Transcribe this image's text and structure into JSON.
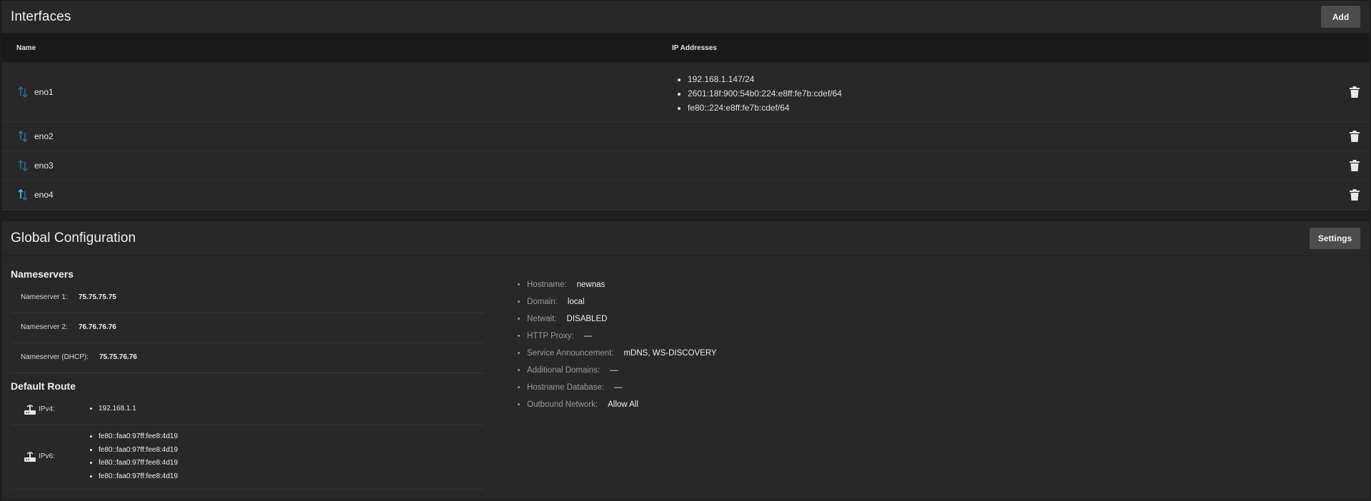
{
  "interfaces": {
    "title": "Interfaces",
    "add_label": "Add",
    "columns": {
      "name": "Name",
      "ip": "IP Addresses"
    },
    "rows": [
      {
        "name": "eno1",
        "ips": [
          "192.168.1.147/24",
          "2601:18f:900:54b0:224:e8ff:fe7b:cdef/64",
          "fe80::224:e8ff:fe7b:cdef/64"
        ]
      },
      {
        "name": "eno2",
        "ips": []
      },
      {
        "name": "eno3",
        "ips": []
      },
      {
        "name": "eno4",
        "ips": []
      }
    ]
  },
  "global": {
    "title": "Global Configuration",
    "settings_label": "Settings",
    "nameservers": {
      "title": "Nameservers",
      "items": [
        {
          "label": "Nameserver 1:",
          "value": "75.75.75.75"
        },
        {
          "label": "Nameserver 2:",
          "value": "76.76.76.76"
        },
        {
          "label": "Nameserver (DHCP):",
          "value": "75.75.76.76"
        }
      ]
    },
    "default_route": {
      "title": "Default Route",
      "ipv4": {
        "label": "IPv4:",
        "values": [
          "192.168.1.1"
        ]
      },
      "ipv6": {
        "label": "IPv6:",
        "values": [
          "fe80::faa0:97ff:fee8:4d19",
          "fe80::faa0:97ff:fee8:4d19",
          "fe80::faa0:97ff:fee8:4d19",
          "fe80::faa0:97ff:fee8:4d19"
        ]
      }
    },
    "settings": [
      {
        "label": "Hostname:",
        "value": "newnas"
      },
      {
        "label": "Domain:",
        "value": "local"
      },
      {
        "label": "Netwait:",
        "value": "DISABLED"
      },
      {
        "label": "HTTP Proxy:",
        "value": "—"
      },
      {
        "label": "Service Announcement:",
        "value": "mDNS, WS-DISCOVERY"
      },
      {
        "label": "Additional Domains:",
        "value": "—"
      },
      {
        "label": "Hostname Database:",
        "value": "—"
      },
      {
        "label": "Outbound Network:",
        "value": "Allow All"
      }
    ]
  },
  "colors": {
    "link_up": "#4fc3f7",
    "link_down": "#2a6f8f",
    "background": "#282828"
  }
}
